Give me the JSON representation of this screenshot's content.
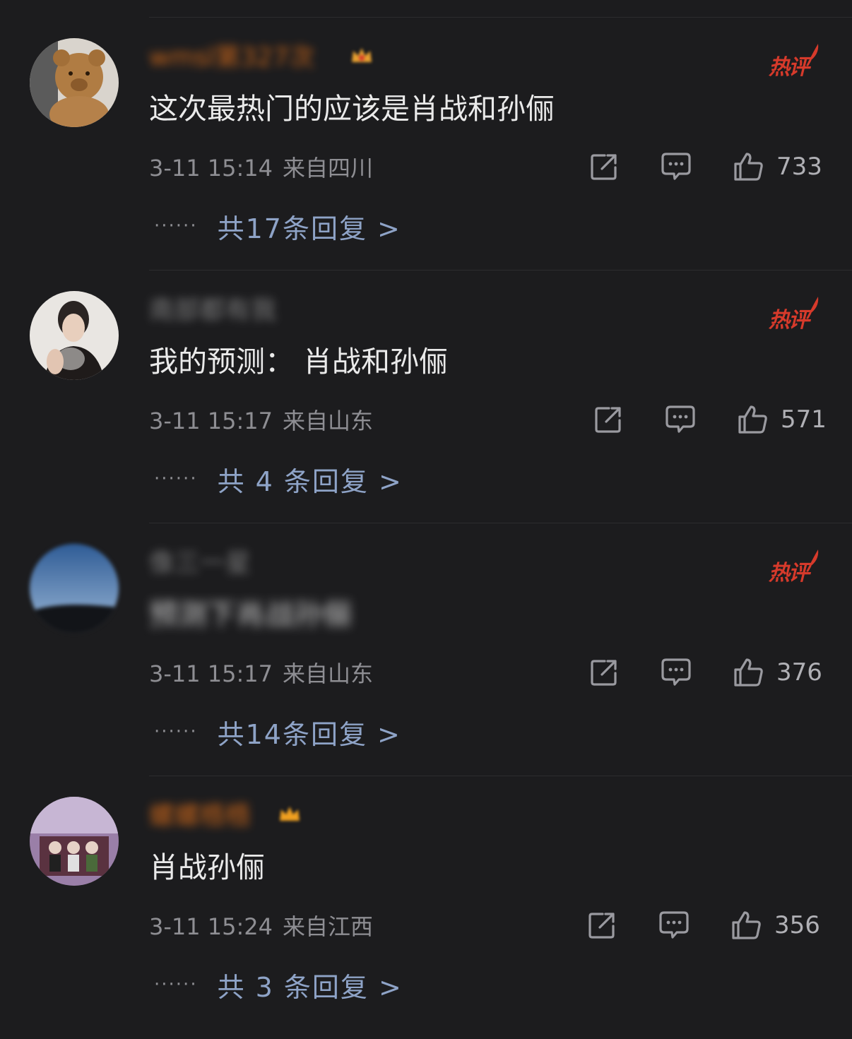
{
  "comments": [
    {
      "username": "wmsl第327次",
      "badge": "热评",
      "content": "这次最热门的应该是肖战和孙俪",
      "time": "3-11 15:14",
      "region": "来自四川",
      "likes": "733",
      "replies": "共17条回复 >"
    },
    {
      "username": "南部都有我",
      "badge": "热评",
      "content": "我的预测： 肖战和孙俪",
      "time": "3-11 15:17",
      "region": "来自山东",
      "likes": "571",
      "replies": "共 4 条回复 >"
    },
    {
      "username": "像三一星",
      "badge": "热评",
      "content": "预测下肖战孙俪",
      "time": "3-11 15:17",
      "region": "来自山东",
      "likes": "376",
      "replies": "共14条回复 >"
    },
    {
      "username": "螺螺梧梧",
      "badge": "",
      "content": "肖战孙俪",
      "time": "3-11 15:24",
      "region": "来自江西",
      "likes": "356",
      "replies": "共 3 条回复 >"
    }
  ],
  "icons": {
    "share": "share-icon",
    "comment": "comment-icon",
    "like": "thumbs-up-icon",
    "crown": "crown-icon"
  },
  "colors": {
    "background": "#1c1c1e",
    "username": "#e8731a",
    "hot_badge": "#d63a2b",
    "reply_link": "#8ea3c7",
    "meta": "#8e8e93"
  }
}
